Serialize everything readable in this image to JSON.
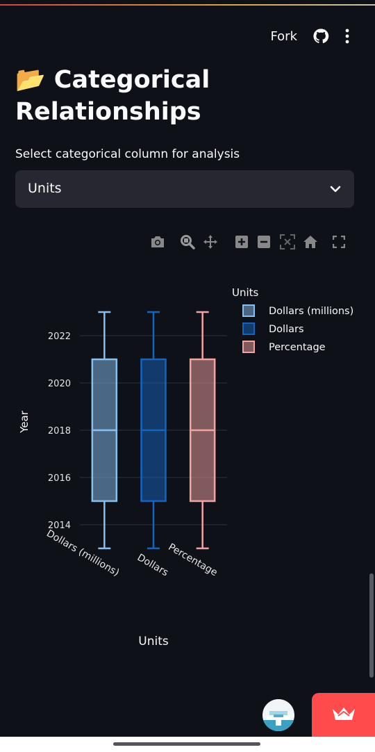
{
  "header": {
    "fork_label": "Fork"
  },
  "title": {
    "emoji": "📂",
    "text": "Categorical Relationships"
  },
  "select": {
    "label": "Select categorical column for analysis",
    "value": "Units"
  },
  "chart_data": {
    "type": "box",
    "ylabel": "Year",
    "xlabel": "Units",
    "legend_title": "Units",
    "legend_position": "top-right",
    "yticks": [
      2014,
      2016,
      2018,
      2020,
      2022
    ],
    "ylim": [
      2012.5,
      2024
    ],
    "grid": true,
    "categories": [
      "Dollars (millions)",
      "Dollars",
      "Percentage"
    ],
    "series": [
      {
        "name": "Dollars (millions)",
        "color": "#86c0f0",
        "min": 2013,
        "q1": 2015,
        "median": 2018,
        "q3": 2021,
        "max": 2023
      },
      {
        "name": "Dollars",
        "color": "#1565c0",
        "min": 2013,
        "q1": 2015,
        "median": 2018,
        "q3": 2021,
        "max": 2023
      },
      {
        "name": "Percentage",
        "color": "#f4a3a3",
        "min": 2013,
        "q1": 2015,
        "median": 2018,
        "q3": 2021,
        "max": 2023
      }
    ]
  },
  "colors": {
    "background": "#0e1117",
    "accent": "#ff4b4b",
    "input_bg": "#262730"
  },
  "icons": {
    "github": "github-icon",
    "menu": "more-vertical-icon",
    "modebar": [
      "camera-icon",
      "zoom-icon",
      "pan-icon",
      "zoom-in-icon",
      "zoom-out-icon",
      "autoscale-icon",
      "home-icon",
      "fullscreen-icon"
    ],
    "deploy": "crown-icon"
  }
}
